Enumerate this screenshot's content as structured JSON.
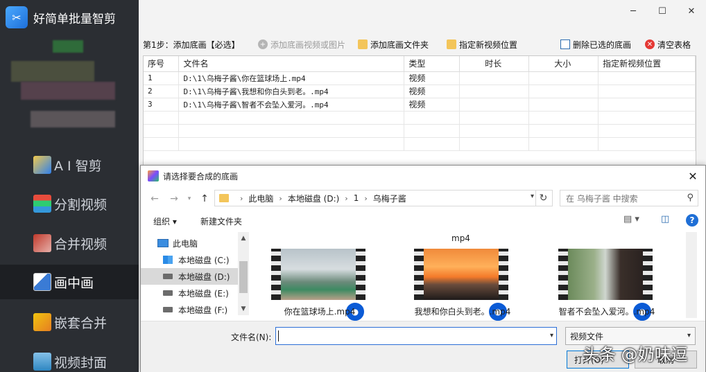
{
  "app": {
    "title": "好简单批量智剪",
    "nav": [
      {
        "label": "A I 智剪",
        "icon": "ai-pen-icon"
      },
      {
        "label": "分割视频",
        "icon": "split-video-icon"
      },
      {
        "label": "合并视频",
        "icon": "merge-video-icon"
      },
      {
        "label": "画中画",
        "icon": "picture-in-picture-icon",
        "active": true
      },
      {
        "label": "嵌套合并",
        "icon": "nested-merge-icon"
      },
      {
        "label": "视频封面",
        "icon": "video-cover-icon"
      }
    ]
  },
  "window_controls": {
    "minimize": "─",
    "maximize": "☐",
    "close": "✕"
  },
  "toolbar": {
    "step": "第1步：添加底画【必选】",
    "add_files": "添加底画视频或图片",
    "add_folder": "添加底画文件夹",
    "set_location": "指定新视频位置",
    "delete_selected": "删除已选的底画",
    "clear_table": "清空表格"
  },
  "grid": {
    "columns": [
      "序号",
      "文件名",
      "类型",
      "时长",
      "大小",
      "指定新视频位置"
    ],
    "rows": [
      {
        "index": "1",
        "file": "D:\\1\\乌梅子酱\\你在篮球场上.mp4",
        "type": "视频",
        "duration": "",
        "size": "",
        "location": ""
      },
      {
        "index": "2",
        "file": "D:\\1\\乌梅子酱\\我想和你白头到老。.mp4",
        "type": "视频",
        "duration": "",
        "size": "",
        "location": ""
      },
      {
        "index": "3",
        "file": "D:\\1\\乌梅子酱\\智者不会坠入爱河。.mp4",
        "type": "视频",
        "duration": "",
        "size": "",
        "location": ""
      }
    ]
  },
  "dialog": {
    "title": "请选择要合成的底画",
    "breadcrumb": [
      "此电脑",
      "本地磁盘 (D:)",
      "1",
      "乌梅子酱"
    ],
    "search_placeholder": "在 乌梅子酱 中搜索",
    "organize": "组织 ▾",
    "new_folder": "新建文件夹",
    "tree": [
      {
        "label": "此电脑",
        "icon": "pc-icon"
      },
      {
        "label": "本地磁盘 (C:)",
        "icon": "windows-drive-icon"
      },
      {
        "label": "本地磁盘 (D:)",
        "icon": "drive-icon",
        "selected": true
      },
      {
        "label": "本地磁盘 (E:)",
        "icon": "drive-icon"
      },
      {
        "label": "本地磁盘 (F:)",
        "icon": "drive-icon"
      }
    ],
    "files_header": "mp4",
    "files": [
      {
        "name": "你在篮球场上.mp4"
      },
      {
        "name": "我想和你白头到老。.mp4"
      },
      {
        "name": "智者不会坠入爱河。.mp4"
      }
    ],
    "filename_label": "文件名(N):",
    "filename_value": "",
    "filetype": "视频文件",
    "open_button": "打开(O)",
    "cancel_button": "取消"
  },
  "watermark": "头条 @奶味逗"
}
